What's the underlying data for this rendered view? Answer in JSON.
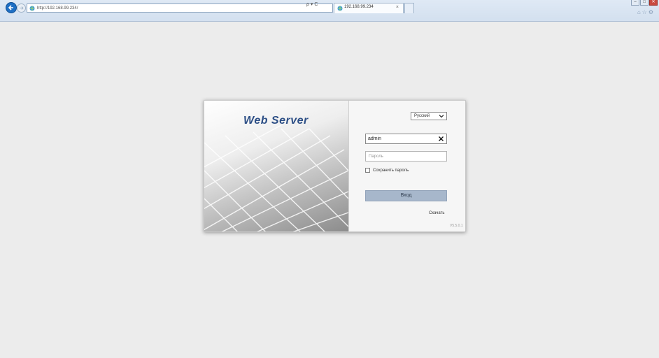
{
  "browser": {
    "url": "http://192.168.99.234/",
    "address_tools": "ρ ▾ C",
    "tab_title": "192.168.99.234",
    "tab_close": "×",
    "window_buttons": {
      "minimize": "–",
      "maximize": "□",
      "close": "✕"
    },
    "toolbar_icons": [
      "home-icon",
      "star-icon",
      "gear-icon"
    ]
  },
  "banner": {
    "title": "Web Server"
  },
  "login": {
    "language": "Русский",
    "username_value": "admin",
    "password_placeholder": "Пароль",
    "remember_label": "Сохранить пароль",
    "remember_checked": false,
    "submit_label": "Вход",
    "download_link": "Скачать",
    "version": "V5.5.0.1"
  },
  "colors": {
    "page_bg": "#ececec",
    "banner_title": "#2d4f86",
    "login_button": "#a7b7cb",
    "back_button": "#1e6fc4"
  }
}
